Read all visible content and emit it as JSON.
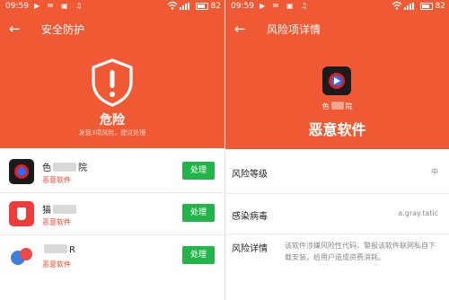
{
  "colors": {
    "accent": "#ef5a35",
    "action_green": "#23b44a",
    "malware_red": "#e9442c"
  },
  "status_bar": {
    "time": "09:59",
    "battery_level": "82",
    "notification_icons": "▶ ✉ ▣ ♫",
    "wifi_icon": "wifi-icon"
  },
  "left_screen": {
    "nav": {
      "back_icon": "←",
      "title": "安全防护"
    },
    "hero": {
      "icon": "shield-warning-icon",
      "title": "危险",
      "subtitle": "发现3项风险，建议处理"
    },
    "risk_items": [
      {
        "name_before": "色",
        "name_after": "院",
        "tag": "恶意软件",
        "action": "处理",
        "icon": "video-player-icon"
      },
      {
        "name_before": "猫",
        "name_after": "",
        "tag": "恶意软件",
        "action": "处理",
        "icon": "cat-app-icon"
      },
      {
        "name_before": "",
        "name_after": "R",
        "tag": "恶意软件",
        "action": "处理",
        "icon": "chat-bubbles-icon"
      }
    ]
  },
  "right_screen": {
    "nav": {
      "back_icon": "←",
      "title": "风险项详情"
    },
    "app": {
      "name_before": "色",
      "name_after": "院",
      "category": "恶意软件",
      "icon": "video-player-icon"
    },
    "details": {
      "risk_level_label": "风险等级",
      "risk_level_value": "中",
      "virus_label": "感染病毒",
      "virus_value": "a.gray.tatic",
      "risk_detail_label": "风险详情",
      "risk_detail_value": "该软件涉嫌风险性代码，警报该软件联网私自下载安装，给用户造成资费消耗。"
    }
  }
}
